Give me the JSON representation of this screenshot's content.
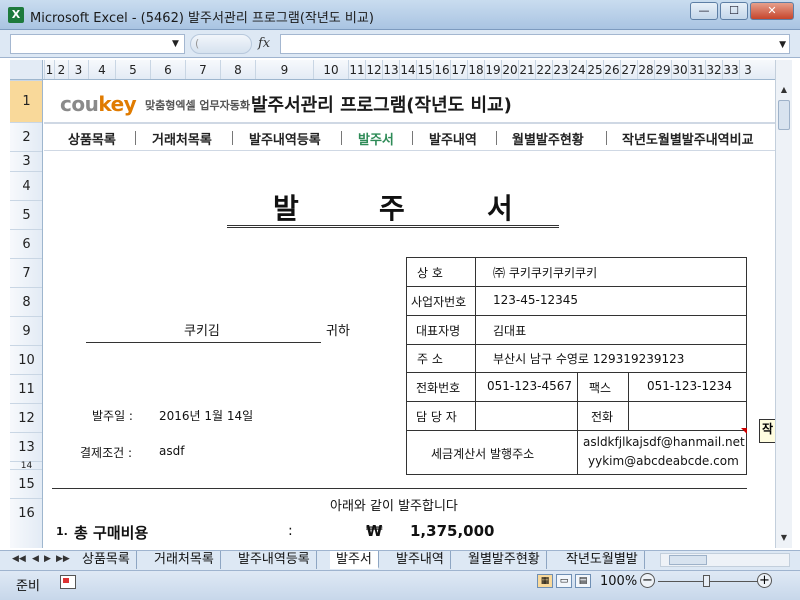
{
  "window": {
    "title": "Microsoft Excel - (5462) 발주서관리 프로그램(작년도 비교)",
    "app_icon_letter": "X",
    "minimize": "—",
    "maximize": "☐",
    "close": "✕"
  },
  "formula_bar": {
    "fx_label": "fx",
    "name_box": "",
    "formula": ""
  },
  "columns": [
    "1",
    "2",
    "3",
    "4",
    "5",
    "6",
    "7",
    "8",
    "9",
    "10",
    "11",
    "12",
    "13",
    "14",
    "15",
    "16",
    "17",
    "18",
    "19",
    "20",
    "21",
    "22",
    "23",
    "24",
    "25",
    "26",
    "27",
    "28",
    "29",
    "30",
    "31",
    "32",
    "33",
    "3"
  ],
  "rows": [
    "1",
    "2",
    "3",
    "4",
    "5",
    "6",
    "7",
    "8",
    "9",
    "10",
    "11",
    "12",
    "13",
    "14",
    "15",
    "16"
  ],
  "header": {
    "logo_main": "cou",
    "logo_key": "key",
    "logo_sub": "맞춤형엑셀 업무자동화",
    "app_title": "발주서관리 프로그램(작년도 비교)"
  },
  "nav": {
    "items": [
      "상품목록",
      "거래처목록",
      "발주내역등록",
      "발주서",
      "발주내역",
      "월별발주현황",
      "작년도월별발주내역비교"
    ],
    "active": "발주서"
  },
  "document": {
    "title_chars": [
      "발",
      "주",
      "서"
    ],
    "recipient_name": "쿠키김",
    "honorific": "귀하",
    "order_date_label": "발주일 :",
    "order_date": "2016년 1월 14일",
    "payment_label": "결제조건 :",
    "payment_value": "asdf"
  },
  "supplier": {
    "company_label": "상     호",
    "company_value": "㈜ 쿠키쿠키쿠키쿠키",
    "bizno_label": "사업자번호",
    "bizno_value": "123-45-12345",
    "ceo_label": "대표자명",
    "ceo_value": "김대표",
    "address_label": "주     소",
    "address_value": "부산시 남구 수영로 129319239123",
    "phone_label": "전화번호",
    "phone_value": "051-123-4567",
    "fax_label": "팩스",
    "fax_value": "051-123-1234",
    "manager_label": "담 당 자",
    "manager_value": "",
    "manager_phone_label": "전화",
    "manager_phone_value": "",
    "tax_email_label": "세금계산서 발행주소",
    "tax_email_1": "asldkfjlkajsdf@hanmail.net",
    "tax_email_2": "yykim@abcdeabcde.com"
  },
  "comment_tip": "작",
  "summary": {
    "notice": "아래와 같이 발주합니다",
    "item_no": "1.",
    "cost_label": "총 구매비용",
    "colon": ":",
    "currency": "₩",
    "cost_value": "1,375,000"
  },
  "sheet_tabs": [
    "상품목록",
    "거래처목록",
    "발주내역등록",
    "발주서",
    "발주내역",
    "월별발주현황",
    "작년도월별발"
  ],
  "active_tab": "발주서",
  "status": {
    "ready": "준비",
    "zoom": "100%",
    "minus": "−",
    "plus": "+"
  }
}
